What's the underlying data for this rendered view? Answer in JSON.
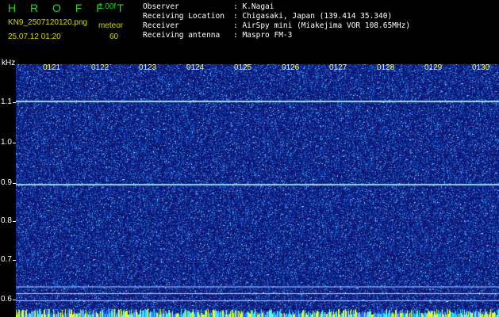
{
  "header": {
    "app_title": "H R O F F T",
    "version": "1.00f",
    "filename": "KN9_2507120120.png",
    "mode": "meteor",
    "datetime": "25.07.12 01:20",
    "interval": "60"
  },
  "info": [
    {
      "key": "Observer",
      "value": ": K.Nagai"
    },
    {
      "key": "Receiving Location",
      "value": ": Chigasaki, Japan (139.414 35.340)"
    },
    {
      "key": "Receiver",
      "value": ": AirSpy mini (Miakejima VOR 108.65MHz)"
    },
    {
      "key": "Receiving antenna",
      "value": ": Maspro FM-3"
    }
  ],
  "axis": {
    "y_unit": "kHz",
    "y_ticks": [
      "1.1",
      "1.0",
      "0.9",
      "0.8",
      "0.7",
      "0.6"
    ],
    "x_ticks": [
      "0121",
      "0122",
      "0123",
      "0124",
      "0125",
      "0126",
      "0127",
      "0128",
      "0129",
      "0130"
    ]
  },
  "colors": {
    "background": "#0b1470",
    "noise": "#3aa0ff",
    "carrier": "#aef0ff",
    "title_green": "#2bd32b",
    "label_yellow": "#d8d800"
  }
}
